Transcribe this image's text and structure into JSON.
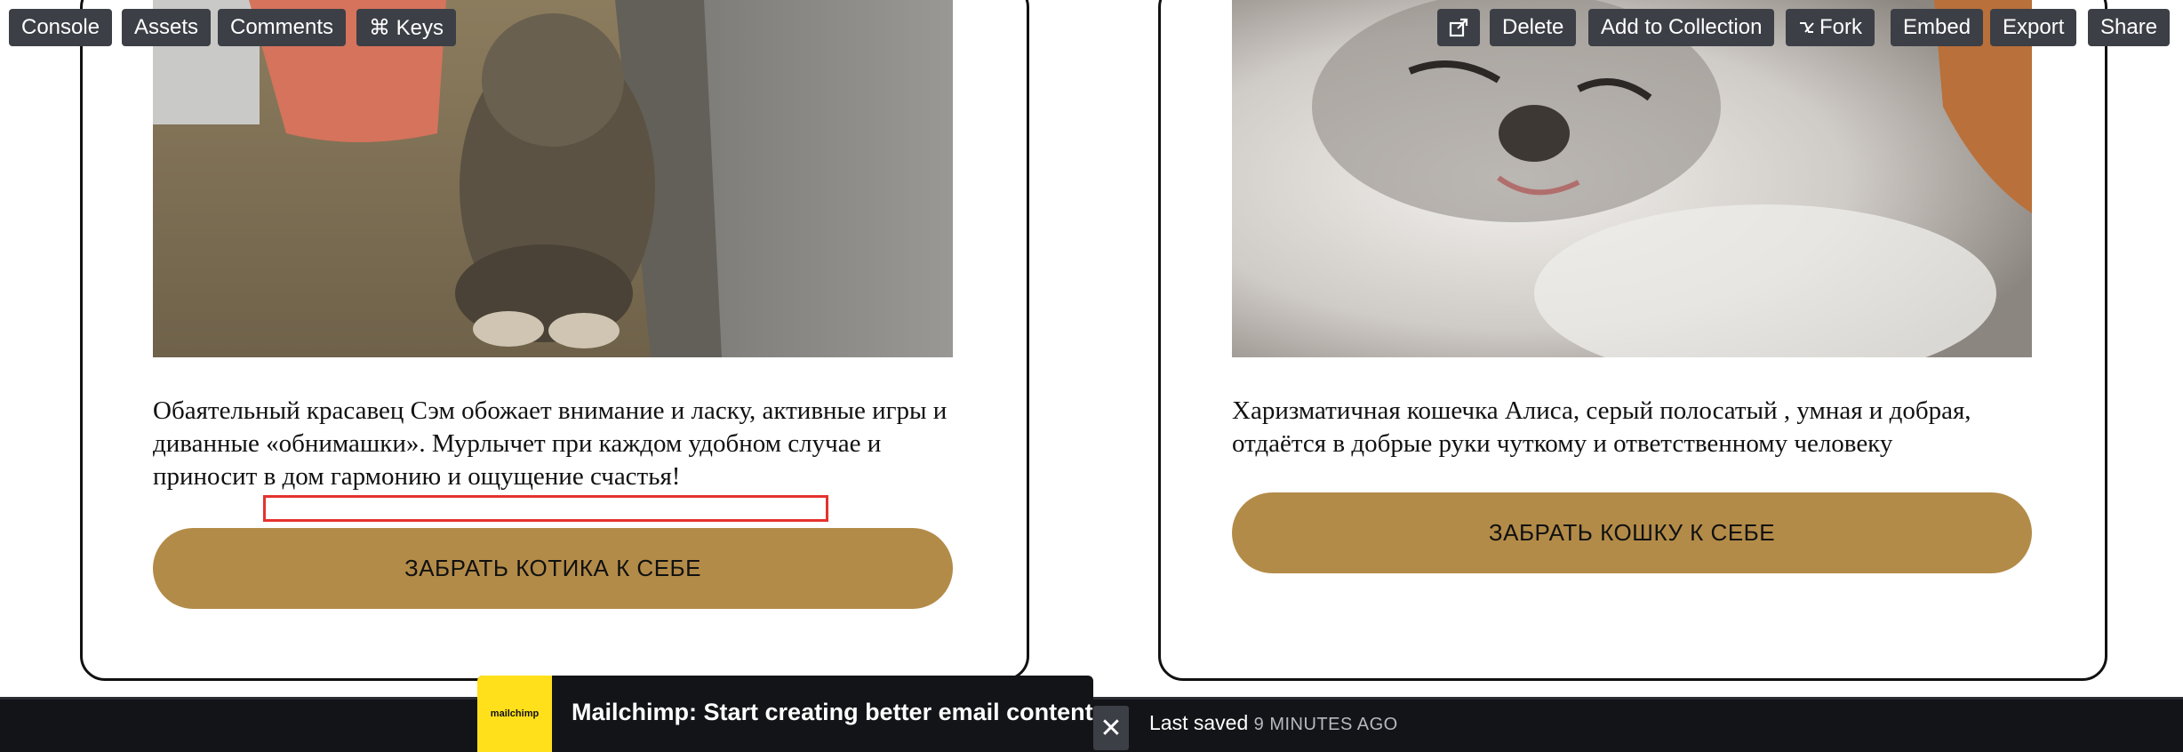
{
  "cards": [
    {
      "description": "Обаятельный красавец Сэм обожает внимание и ласку, активные игры и диванные «обнимашки». Мурлычет при каждом удобном случае и приносит в дом гармонию и ощущение счастья!",
      "button_label": "ЗАБРАТЬ КОТИКА К СЕБЕ"
    },
    {
      "description": "Харизматичная кошечка Алиса, серый полосатый , умная и добрая, отдаётся в добрые руки чуткому и ответственному человеку",
      "button_label": "ЗАБРАТЬ КОШКУ К СЕБЕ"
    }
  ],
  "toolbar": {
    "console": "Console",
    "assets": "Assets",
    "comments": "Comments",
    "keys": "⌘ Keys",
    "ad_logo": "mailchimp",
    "ad_text": "Mailchimp: Start creating better email content …",
    "close_glyph": "✕",
    "last_saved": "Last saved",
    "saved_ago": "9 MINUTES AGO",
    "delete": "Delete",
    "add_to_collection": "Add to Collection",
    "fork": "Fork",
    "embed": "Embed",
    "export": "Export",
    "share": "Share"
  },
  "colors": {
    "accent_button": "#b38b48",
    "highlight_border": "#e5322d",
    "toolbar_bg": "#131417",
    "toolbar_button": "#3c3f46",
    "mailchimp_yellow": "#ffe01b"
  },
  "icons": [
    "external-link-icon",
    "fork-icon",
    "close-icon",
    "mailchimp-logo-icon"
  ]
}
